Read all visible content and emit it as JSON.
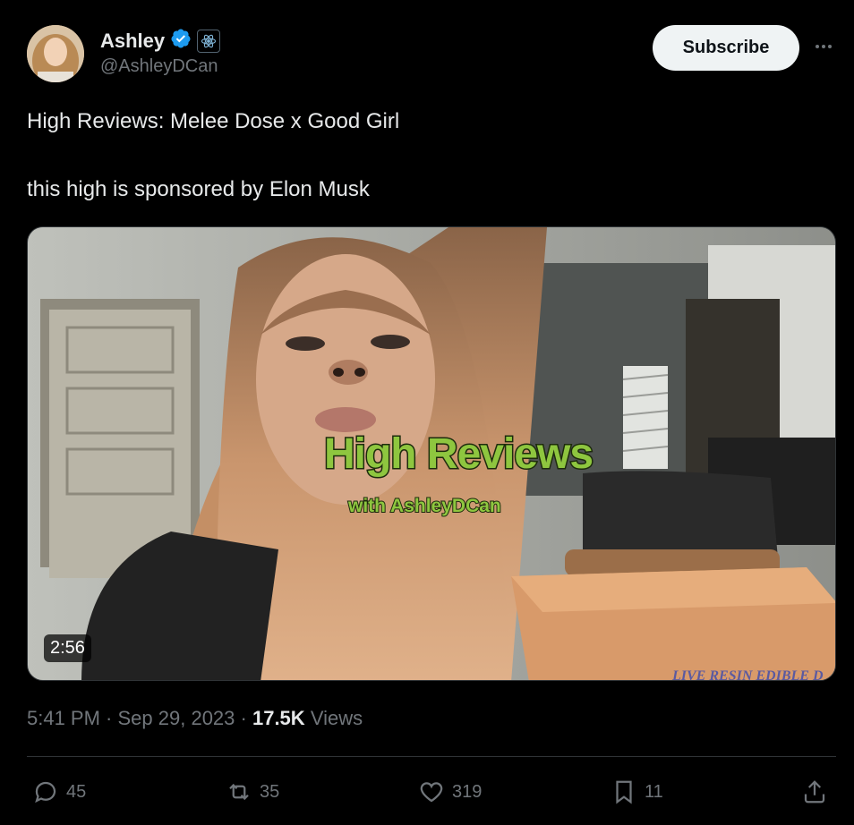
{
  "author": {
    "name": "Ashley",
    "handle": "@AshleyDCan",
    "verified_icon": "verified-badge-icon",
    "affiliation_icon": "atom-icon"
  },
  "header": {
    "subscribe_label": "Subscribe",
    "more_icon": "more-icon"
  },
  "post": {
    "line1": "High Reviews: Melee Dose x Good Girl",
    "line2": "this high is sponsored by Elon Musk"
  },
  "video": {
    "overlay_title": "High Reviews",
    "overlay_subtitle": "with AshleyDCan",
    "box_text": "LIVE RESIN EDIBLE D",
    "duration": "2:56"
  },
  "meta": {
    "time": "5:41 PM",
    "date": "Sep 29, 2023",
    "views_count": "17.5K",
    "views_label": "Views"
  },
  "actions": {
    "replies": "45",
    "reposts": "35",
    "likes": "319",
    "bookmarks": "11"
  },
  "colors": {
    "background": "#000000",
    "text": "#e7e9ea",
    "muted": "#71767b",
    "verified": "#1d9bf0",
    "overlay_green": "#8ec63f"
  }
}
